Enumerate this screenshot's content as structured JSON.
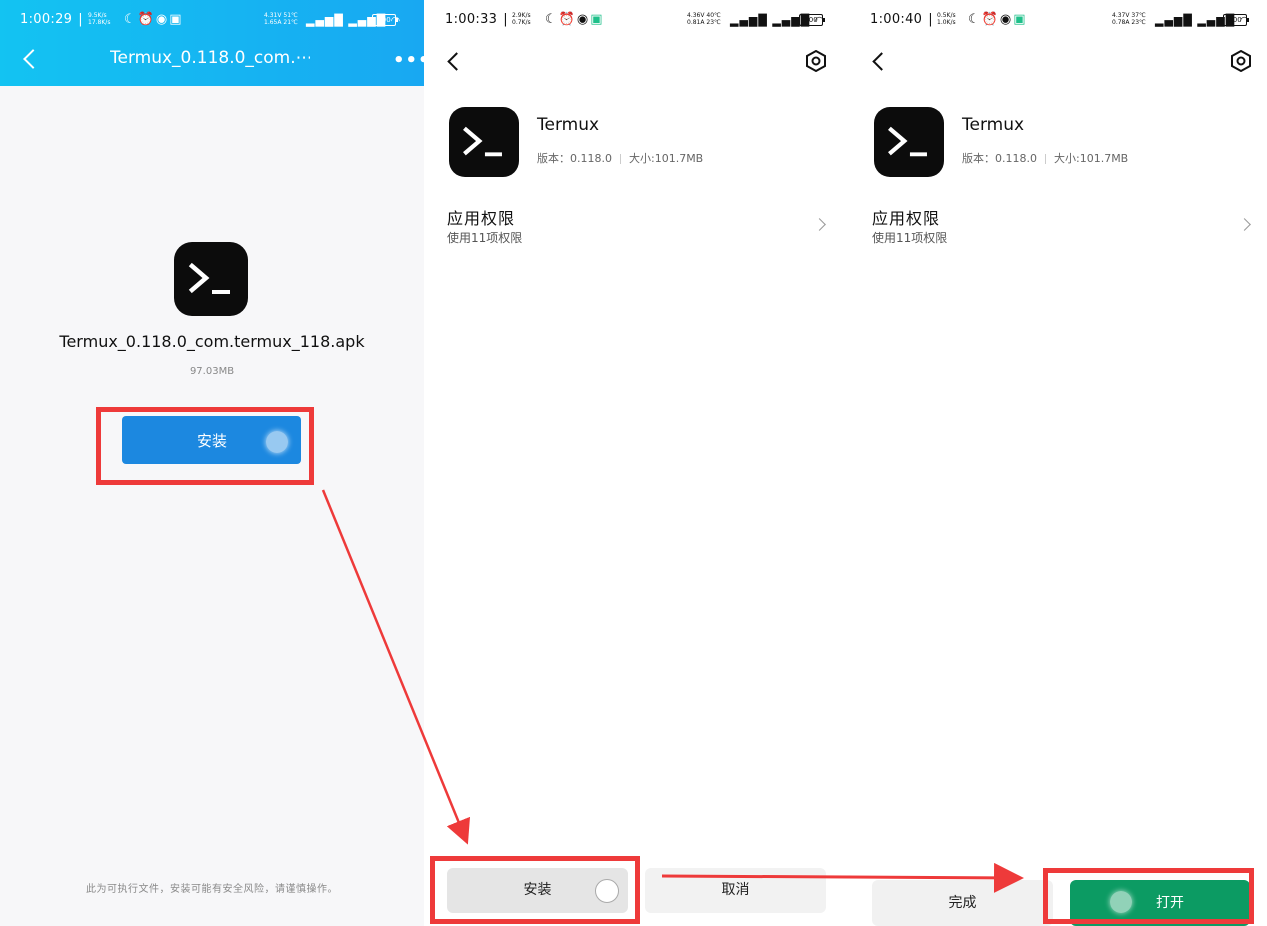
{
  "panel1": {
    "status": {
      "time": "1:00:29",
      "speed": [
        "9.5K/s",
        "17.8K/s"
      ],
      "volt": [
        "4.31V 51℃",
        "1.65A 21℃"
      ],
      "battery": "100"
    },
    "header_title": "Termux_0.118.0_com.⋯",
    "file_name": "Termux_0.118.0_com.termux_118.apk",
    "file_size": "97.03MB",
    "install_label": "安装",
    "warning": "此为可执行文件，安装可能有安全风险，请谨慎操作。"
  },
  "panel2": {
    "status": {
      "time": "1:00:33",
      "speed": [
        "2.9K/s",
        "0.7K/s"
      ],
      "volt": [
        "4.36V 40℃",
        "0.81A 23℃"
      ],
      "battery": "100"
    },
    "app_name": "Termux",
    "version_label": "版本：0.118.0",
    "size_label": "大小:101.7MB",
    "perm_title": "应用权限",
    "perm_sub": "使用11项权限",
    "install_label": "安装",
    "cancel_label": "取消"
  },
  "panel3": {
    "status": {
      "time": "1:00:40",
      "speed": [
        "0.5K/s",
        "1.0K/s"
      ],
      "volt": [
        "4.37V 37℃",
        "0.78A 23℃"
      ],
      "battery": "100"
    },
    "app_name": "Termux",
    "version_label": "版本：0.118.0",
    "size_label": "大小:101.7MB",
    "perm_title": "应用权限",
    "perm_sub": "使用11项权限",
    "done_label": "完成",
    "open_label": "打开"
  },
  "colors": {
    "highlight": "#ee3a3a",
    "install_blue": "#1c88e0",
    "open_green": "#0c9b63",
    "header_blue": "#13c3f2"
  }
}
